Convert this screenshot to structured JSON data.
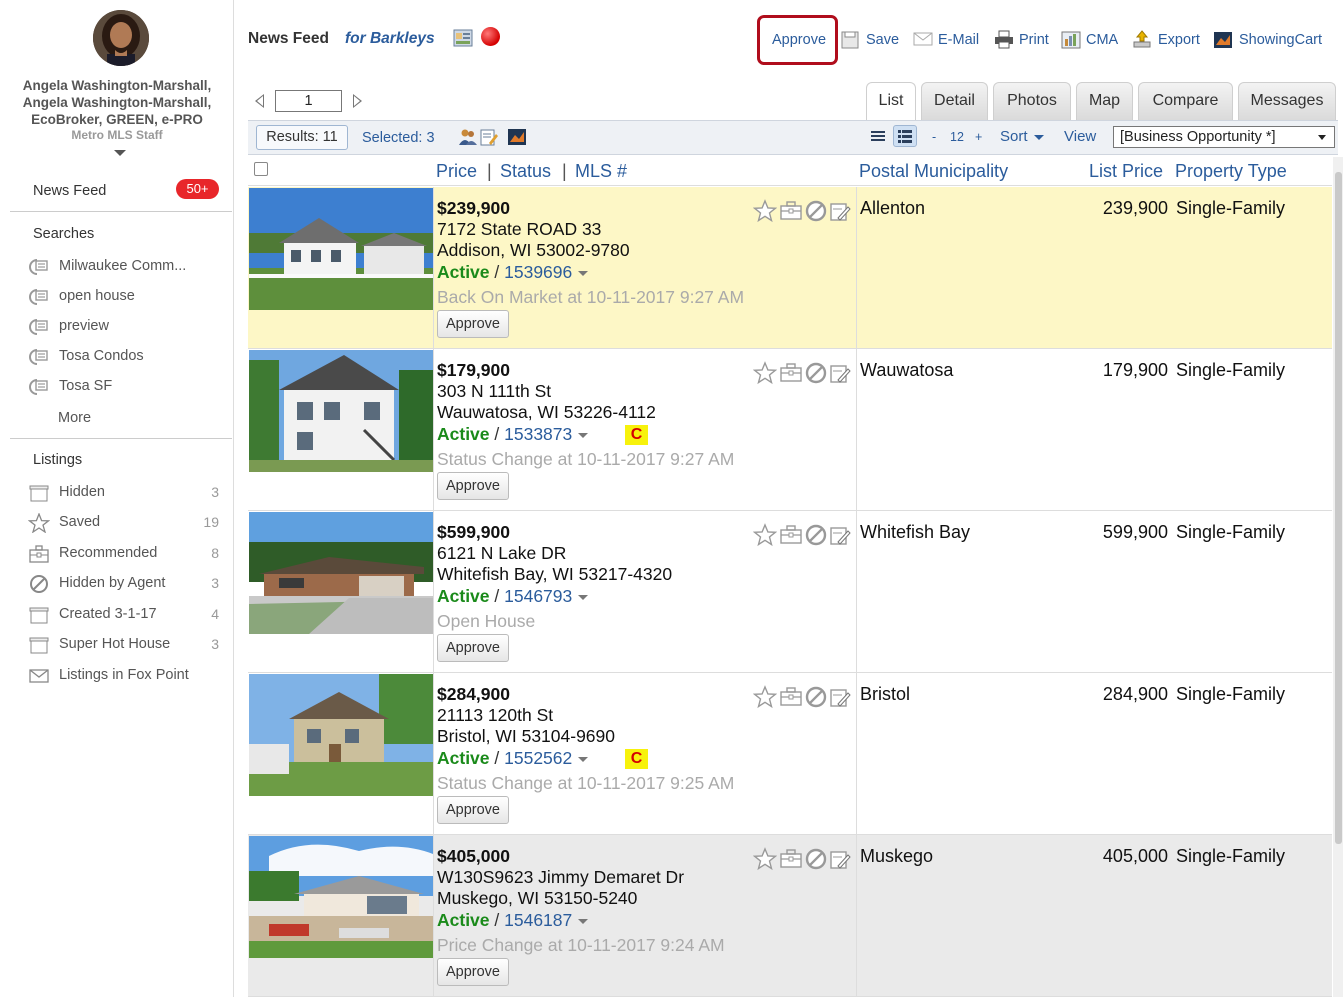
{
  "sidebar": {
    "agent_name_line1": "Angela Washington-Marshall,",
    "agent_name_line2": "Angela Washington-Marshall,",
    "agent_name_line3": "EcoBroker, GREEN, e-PRO",
    "agent_role": "Metro MLS Staff",
    "news_feed_label": "News Feed",
    "news_feed_badge": "50+",
    "searches_heading": "Searches",
    "searches": [
      {
        "label": "Milwaukee Comm..."
      },
      {
        "label": "open house"
      },
      {
        "label": "preview"
      },
      {
        "label": "Tosa Condos"
      },
      {
        "label": "Tosa SF"
      }
    ],
    "more_label": "More",
    "listings_heading": "Listings",
    "listings": [
      {
        "label": "Hidden",
        "count": "3",
        "icon": "folder-icon"
      },
      {
        "label": "Saved",
        "count": "19",
        "icon": "star-icon"
      },
      {
        "label": "Recommended",
        "count": "8",
        "icon": "briefcase-icon"
      },
      {
        "label": "Hidden by Agent",
        "count": "3",
        "icon": "no-entry-icon"
      },
      {
        "label": "Created 3-1-17",
        "count": "4",
        "icon": "folder-icon"
      },
      {
        "label": "Super Hot House",
        "count": "3",
        "icon": "folder-icon"
      },
      {
        "label": "Listings in Fox Point",
        "count": "",
        "icon": "envelope-icon"
      }
    ]
  },
  "header": {
    "title": "News Feed",
    "for_label": "for Barkleys",
    "approve_label": "Approve",
    "toolbar": {
      "save": "Save",
      "email": "E-Mail",
      "print": "Print",
      "cma": "CMA",
      "export": "Export",
      "showing_cart": "ShowingCart"
    }
  },
  "pager": {
    "page": "1"
  },
  "tabs": [
    {
      "label": "List",
      "active": true
    },
    {
      "label": "Detail"
    },
    {
      "label": "Photos"
    },
    {
      "label": "Map"
    },
    {
      "label": "Compare"
    },
    {
      "label": "Messages"
    }
  ],
  "results_bar": {
    "results": "Results: 11",
    "selected": "Selected: 3",
    "minus": "-",
    "per_page": "12",
    "plus": "+",
    "sort": "Sort",
    "view": "View",
    "view_select": "[Business Opportunity *]"
  },
  "columns": {
    "price": "Price",
    "sep1": "|",
    "status": "Status",
    "sep2": "|",
    "mls": "MLS #",
    "municipality": "Postal Municipality",
    "list_price": "List Price",
    "property_type": "Property Type"
  },
  "listings": [
    {
      "num": "1",
      "checked": true,
      "style": "hl",
      "price": "$239,900",
      "addr1": "7172 State ROAD 33",
      "addr2": "Addison, WI 53002-9780",
      "status": "Active",
      "sep": " / ",
      "mls": "1539696",
      "badge": "",
      "change": "Back On Market at 10-11-2017 9:27 AM",
      "approve": "Approve",
      "municipality": "Allenton",
      "list_price": "239,900",
      "type": "Single-Family"
    },
    {
      "num": "2",
      "checked": false,
      "style": "",
      "price": "$179,900",
      "addr1": "303 N 111th St",
      "addr2": "Wauwatosa, WI 53226-4112",
      "status": "Active",
      "sep": " / ",
      "mls": "1533873",
      "badge": "C",
      "change": "Status Change at 10-11-2017 9:27 AM",
      "approve": "Approve",
      "municipality": "Wauwatosa",
      "list_price": "179,900",
      "type": "Single-Family"
    },
    {
      "num": "3",
      "checked": true,
      "style": "",
      "price": "$599,900",
      "addr1": "6121 N Lake DR",
      "addr2": "Whitefish Bay, WI 53217-4320",
      "status": "Active",
      "sep": " / ",
      "mls": "1546793",
      "badge": "",
      "change": "Open House",
      "approve": "Approve",
      "municipality": "Whitefish Bay",
      "list_price": "599,900",
      "type": "Single-Family"
    },
    {
      "num": "4",
      "checked": false,
      "style": "",
      "price": "$284,900",
      "addr1": "21113 120th St",
      "addr2": "Bristol, WI 53104-9690",
      "status": "Active",
      "sep": " / ",
      "mls": "1552562",
      "badge": "C",
      "change": "Status Change at 10-11-2017 9:25 AM",
      "approve": "Approve",
      "municipality": "Bristol",
      "list_price": "284,900",
      "type": "Single-Family"
    },
    {
      "num": "5",
      "checked": true,
      "style": "gray",
      "price": "$405,000",
      "addr1": "W130S9623 Jimmy Demaret Dr",
      "addr2": "Muskego, WI 53150-5240",
      "status": "Active",
      "sep": " / ",
      "mls": "1546187",
      "badge": "",
      "change": "Price Change at 10-11-2017 9:24 AM",
      "approve": "Approve",
      "municipality": "Muskego",
      "list_price": "405,000",
      "type": "Single-Family"
    }
  ],
  "colors": {
    "link": "#2b5c9c",
    "active_status": "#1a8a1a",
    "badge_red": "#e8262a",
    "highlight_row": "#fdf7c6",
    "approve_outline": "#b00d1c"
  }
}
